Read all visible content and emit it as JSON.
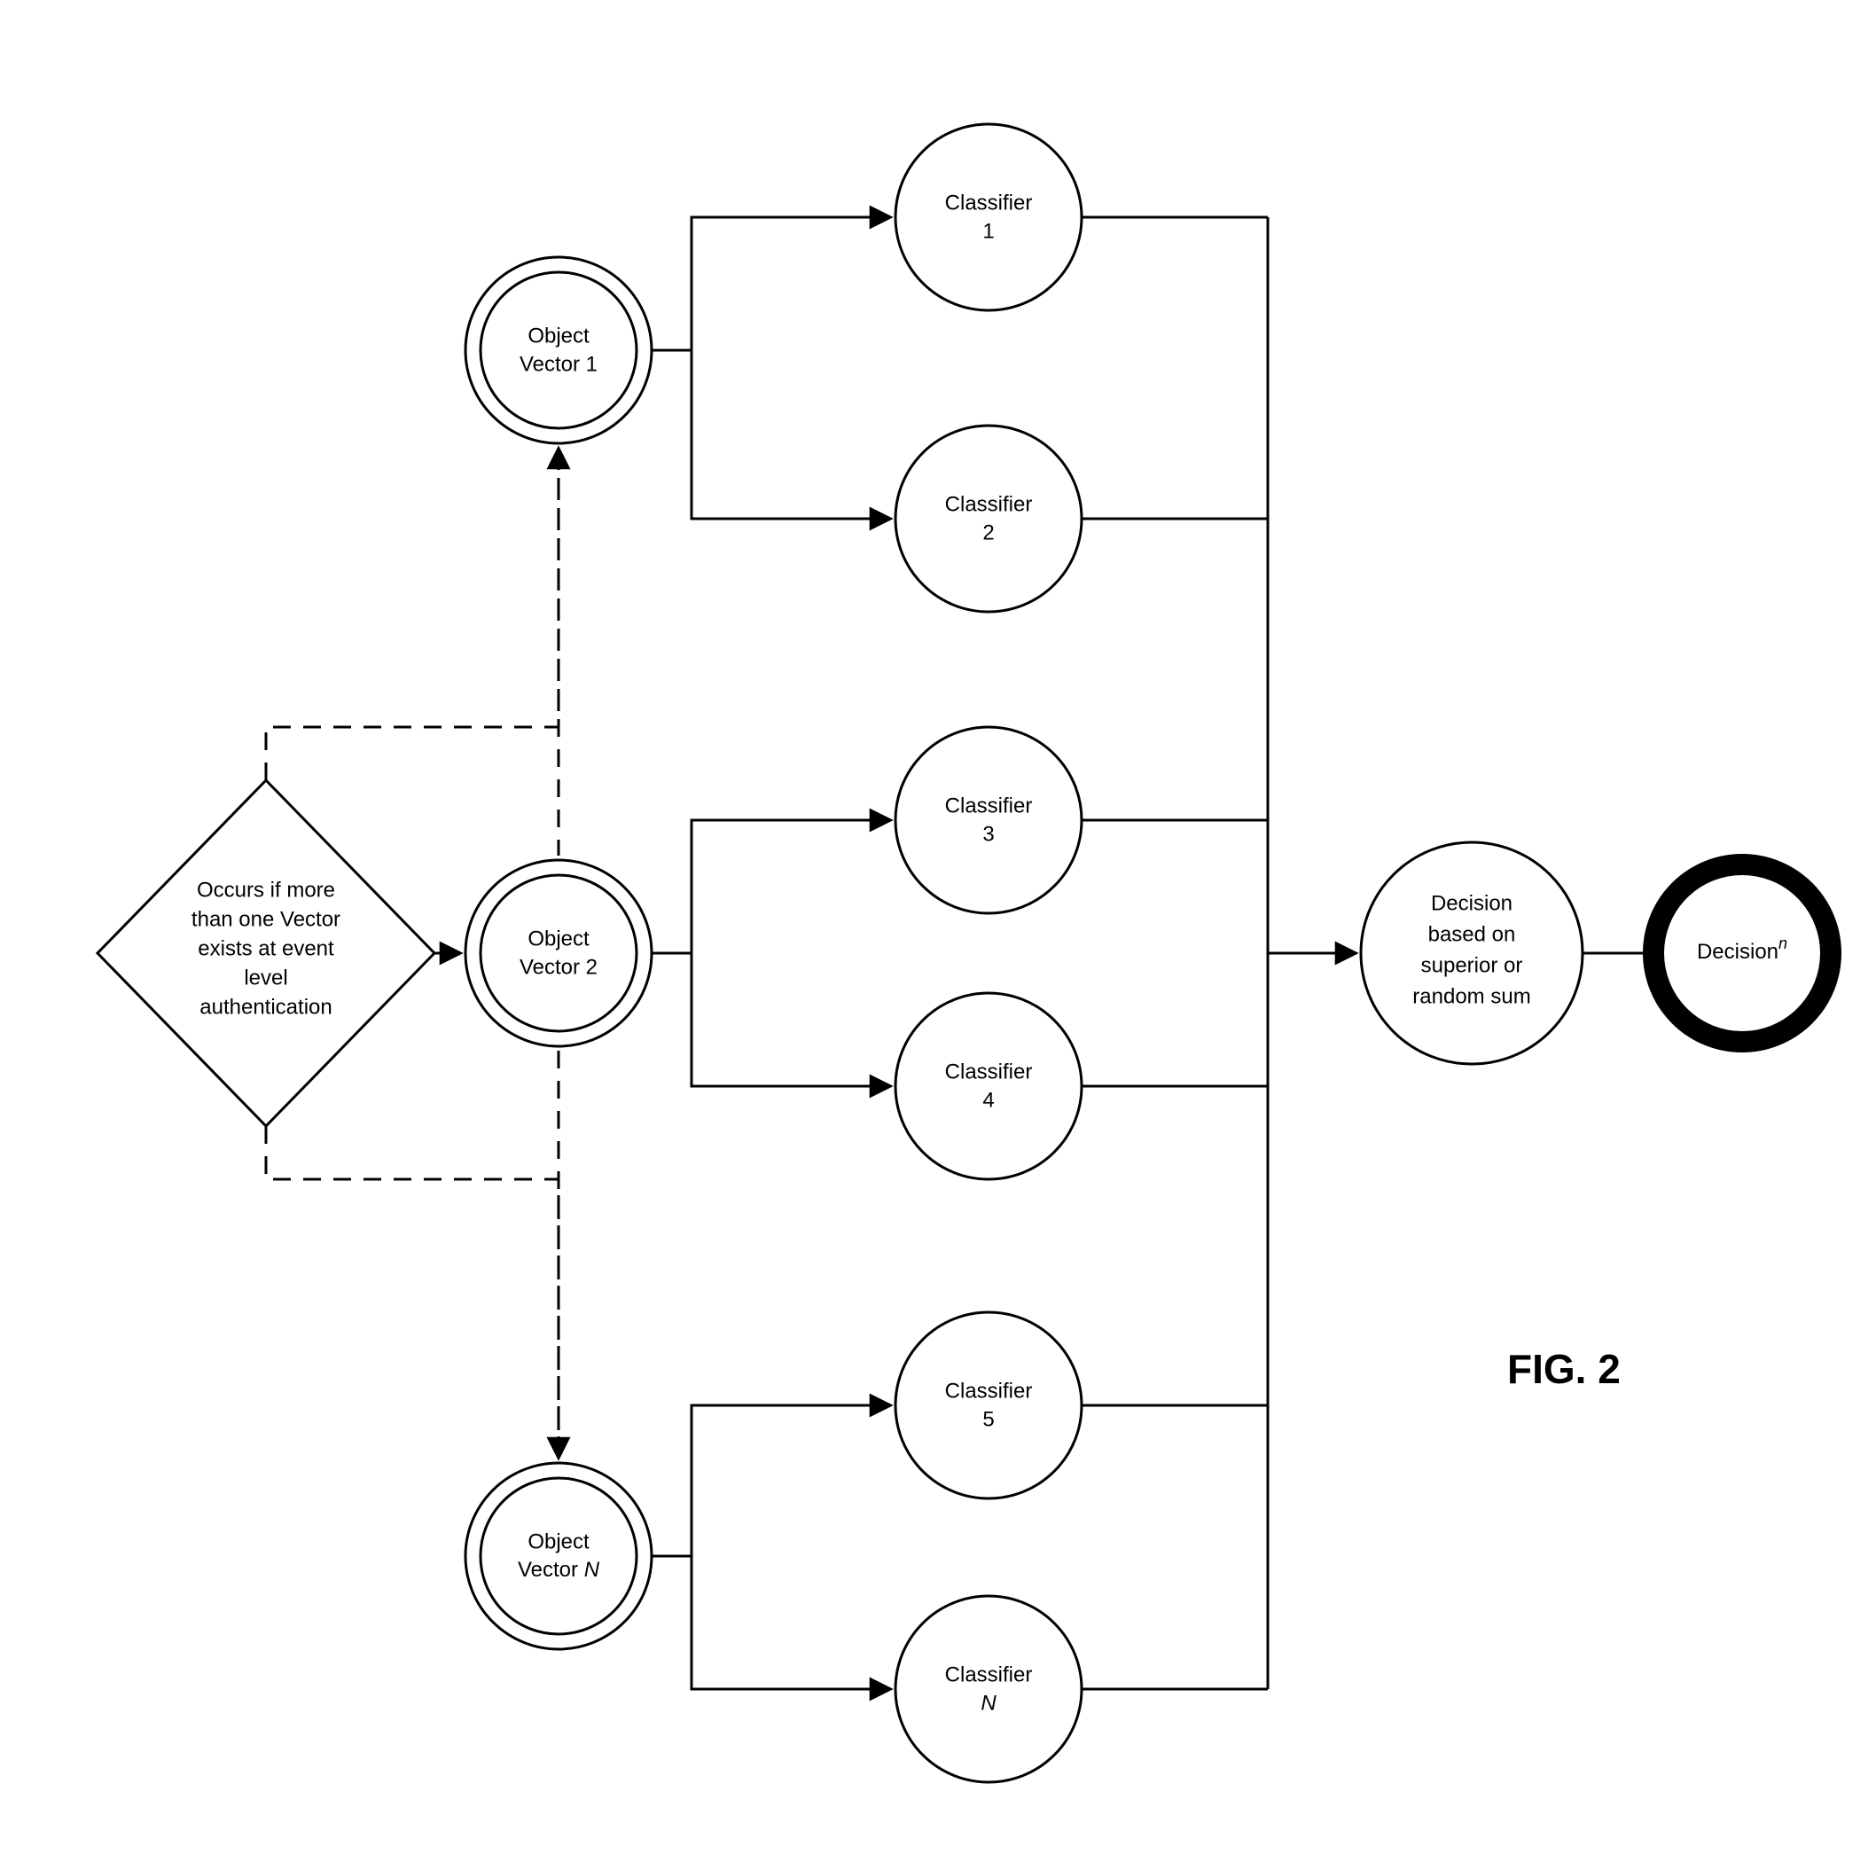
{
  "condition": {
    "l1": "Occurs if more",
    "l2": "than one Vector",
    "l3": "exists at event",
    "l4": "level",
    "l5": "authentication"
  },
  "vectors": {
    "v1": {
      "l1": "Object",
      "l2": "Vector 1"
    },
    "v2": {
      "l1": "Object",
      "l2": "Vector 2"
    },
    "vN": {
      "l1": "Object",
      "l2a": "Vector ",
      "l2b": "N"
    }
  },
  "classifiers": {
    "c1": {
      "l1": "Classifier",
      "l2": "1"
    },
    "c2": {
      "l1": "Classifier",
      "l2": "2"
    },
    "c3": {
      "l1": "Classifier",
      "l2": "3"
    },
    "c4": {
      "l1": "Classifier",
      "l2": "4"
    },
    "c5": {
      "l1": "Classifier",
      "l2": "5"
    },
    "cN": {
      "l1": "Classifier",
      "l2": "N"
    }
  },
  "decision_basis": {
    "l1": "Decision",
    "l2": "based on",
    "l3": "superior or",
    "l4": "random sum"
  },
  "decision": {
    "label": "Decision",
    "sup": "n"
  },
  "figure": "FIG. 2"
}
